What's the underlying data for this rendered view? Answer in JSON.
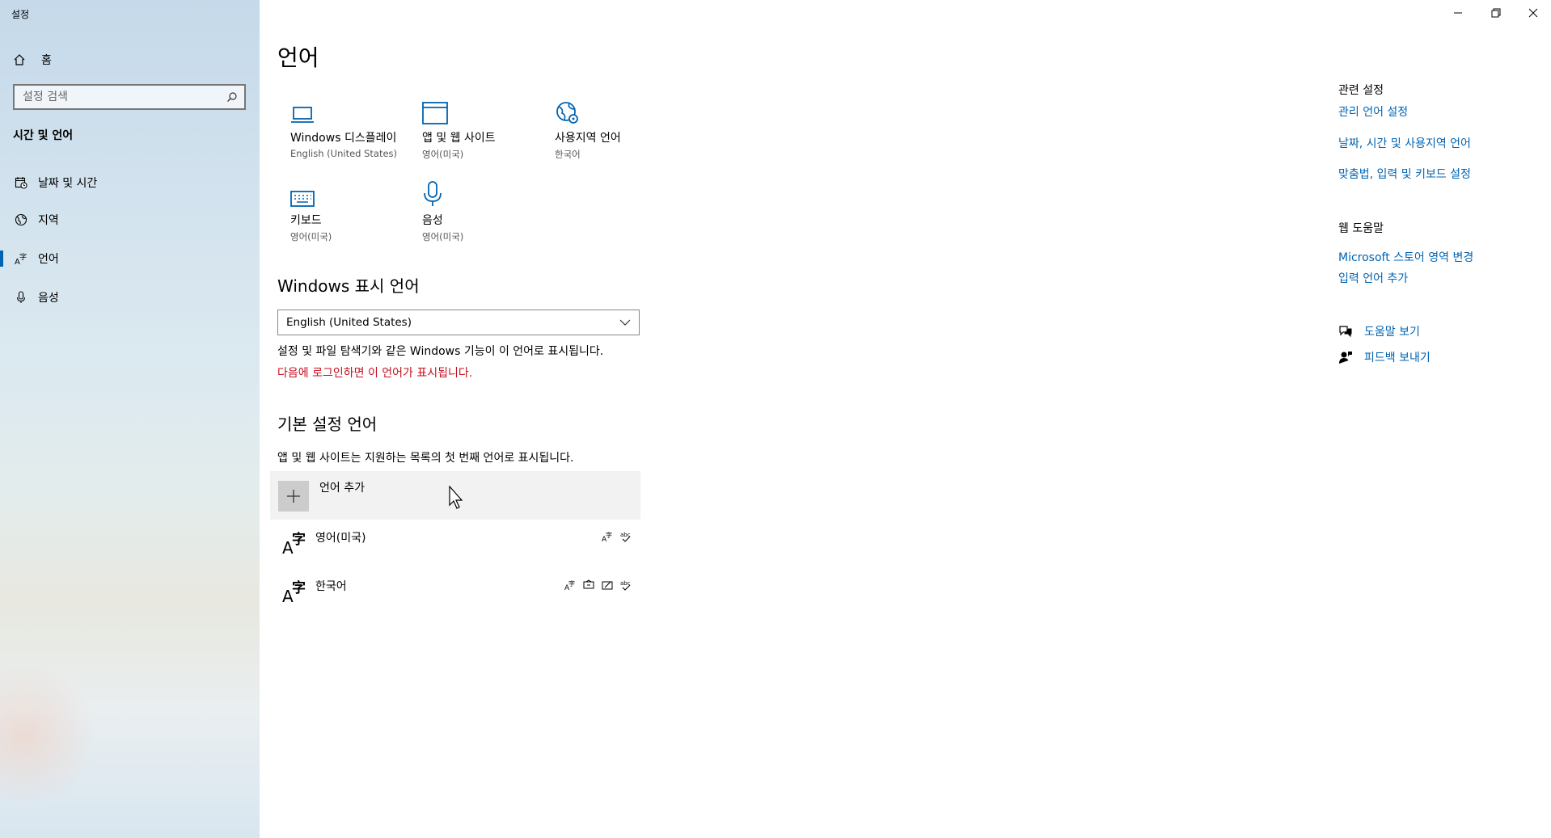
{
  "window": {
    "title": "설정"
  },
  "sidebar": {
    "home_label": "홈",
    "search_placeholder": "설정 검색",
    "section_title": "시간 및 언어",
    "items": [
      {
        "label": "날짜 및 시간",
        "icon": "calendar-clock-icon"
      },
      {
        "label": "지역",
        "icon": "globe-icon"
      },
      {
        "label": "언어",
        "icon": "language-icon",
        "active": true
      },
      {
        "label": "음성",
        "icon": "microphone-icon"
      }
    ]
  },
  "main": {
    "title": "언어",
    "tiles": [
      {
        "label": "Windows 디스플레이",
        "sub": "English (United States)",
        "icon": "laptop-icon"
      },
      {
        "label": "앱 및 웹 사이트",
        "sub": "영어(미국)",
        "icon": "window-icon"
      },
      {
        "label": "사용지역 언어",
        "sub": "한국어",
        "icon": "globe-settings-icon"
      },
      {
        "label": "키보드",
        "sub": "영어(미국)",
        "icon": "keyboard-icon"
      },
      {
        "label": "음성",
        "sub": "영어(미국)",
        "icon": "microphone-icon"
      }
    ],
    "display_language": {
      "heading": "Windows 표시 언어",
      "selected": "English (United States)",
      "description": "설정 및 파일 탐색기와 같은 Windows 기능이 이 언어로 표시됩니다.",
      "warning": "다음에 로그인하면 이 언어가 표시됩니다."
    },
    "preferred": {
      "heading": "기본 설정 언어",
      "description": "앱 및 웹 사이트는 지원하는 목록의 첫 번째 언어로 표시됩니다.",
      "add_label": "언어 추가",
      "languages": [
        {
          "name": "영어(미국)",
          "features": [
            "display-language-icon",
            "spellcheck-icon"
          ]
        },
        {
          "name": "한국어",
          "features": [
            "display-language-icon",
            "speech-icon",
            "handwriting-icon",
            "spellcheck-icon"
          ]
        }
      ]
    }
  },
  "related": {
    "heading": "관련 설정",
    "links": [
      "관리 언어 설정",
      "날짜, 시간 및 사용지역 언어",
      "맞춤법, 입력 및 키보드 설정"
    ]
  },
  "web_help": {
    "heading": "웹 도움말",
    "links": [
      "Microsoft 스토어 영역 변경",
      "입력 언어 추가"
    ]
  },
  "help": {
    "get_help": "도움말 보기",
    "feedback": "피드백 보내기"
  },
  "colors": {
    "accent": "#0063b1",
    "warning": "#c50f1f"
  }
}
